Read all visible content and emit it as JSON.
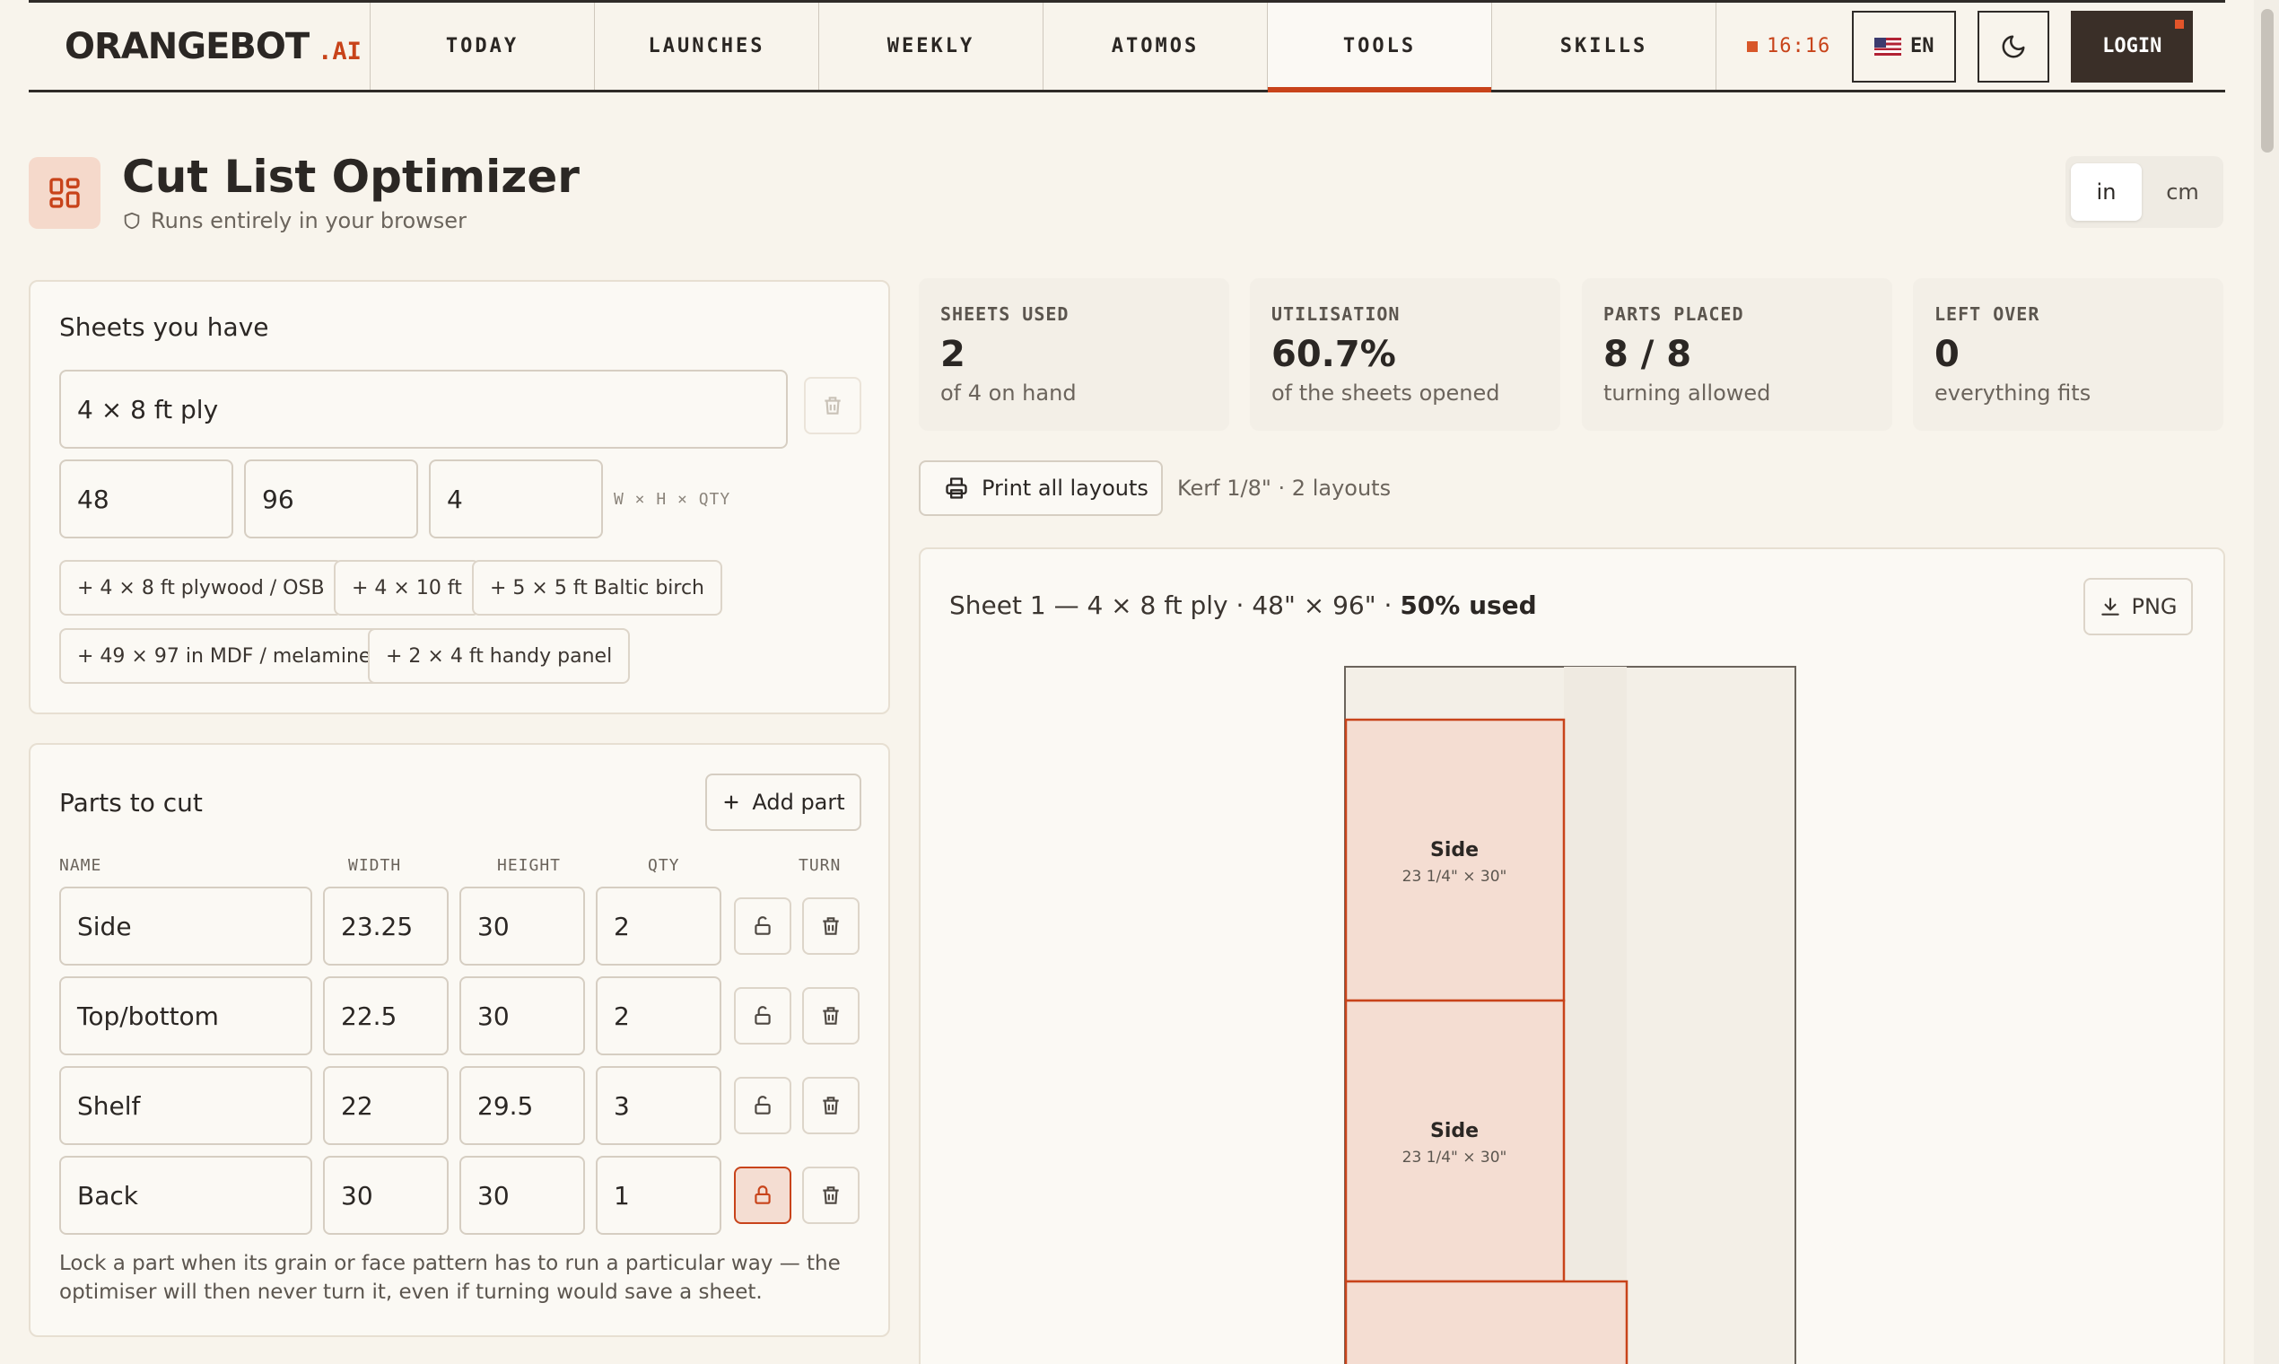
{
  "brand": {
    "name": "ORANGEBOT",
    "suffix": ".AI"
  },
  "nav": {
    "items": [
      {
        "label": "TODAY"
      },
      {
        "label": "LAUNCHES"
      },
      {
        "label": "WEEKLY"
      },
      {
        "label": "ATOMOS"
      },
      {
        "label": "TOOLS",
        "active": true
      },
      {
        "label": "SKILLS"
      }
    ],
    "clock": "16:16",
    "lang": "EN",
    "login": "LOGIN"
  },
  "header": {
    "title": "Cut List Optimizer",
    "subtitle": "Runs entirely in your browser",
    "units": [
      "in",
      "cm"
    ],
    "active_unit": "in"
  },
  "sheets": {
    "title": "Sheets you have",
    "name_value": "4 × 8 ft ply",
    "width": "48",
    "height": "96",
    "qty": "4",
    "dims_hint": "W × H × QTY",
    "presets": [
      "+ 4 × 8 ft plywood / OSB",
      "+ 4 × 10 ft",
      "+ 5 × 5 ft Baltic birch",
      "+ 49 × 97 in MDF / melamine",
      "+ 2 × 4 ft handy panel"
    ]
  },
  "parts": {
    "title": "Parts to cut",
    "add_label": "Add part",
    "columns": [
      "NAME",
      "WIDTH",
      "HEIGHT",
      "QTY",
      "TURN"
    ],
    "rows": [
      {
        "name": "Side",
        "width": "23.25",
        "height": "30",
        "qty": "2",
        "locked": false
      },
      {
        "name": "Top/bottom",
        "width": "22.5",
        "height": "30",
        "qty": "2",
        "locked": false
      },
      {
        "name": "Shelf",
        "width": "22",
        "height": "29.5",
        "qty": "3",
        "locked": false
      },
      {
        "name": "Back",
        "width": "30",
        "height": "30",
        "qty": "1",
        "locked": true
      }
    ],
    "note": "Lock a part when its grain or face pattern has to run a particular way — the optimiser will then never turn it, even if turning would save a sheet."
  },
  "stats": [
    {
      "label": "SHEETS USED",
      "value": "2",
      "sub": "of 4 on hand"
    },
    {
      "label": "UTILISATION",
      "value": "60.7%",
      "sub": "of the sheets opened"
    },
    {
      "label": "PARTS PLACED",
      "value": "8 / 8",
      "sub": "turning allowed"
    },
    {
      "label": "LEFT OVER",
      "value": "0",
      "sub": "everything fits"
    }
  ],
  "actions": {
    "print_label": "Print all layouts",
    "kerf_info": "Kerf 1/8\" · 2 layouts"
  },
  "layout": {
    "sheet_title": "Sheet 1 — 4 × 8 ft ply · 48\" × 96\" · ",
    "sheet_used": "50% used",
    "png_label": "PNG",
    "parts": [
      {
        "name": "Side",
        "dims": "23 1/4\" × 30\""
      },
      {
        "name": "Side",
        "dims": "23 1/4\" × 30\""
      }
    ]
  },
  "colors": {
    "accent": "#c8431a",
    "part_fill": "#f4ddd2",
    "background": "#f8f4ec"
  }
}
